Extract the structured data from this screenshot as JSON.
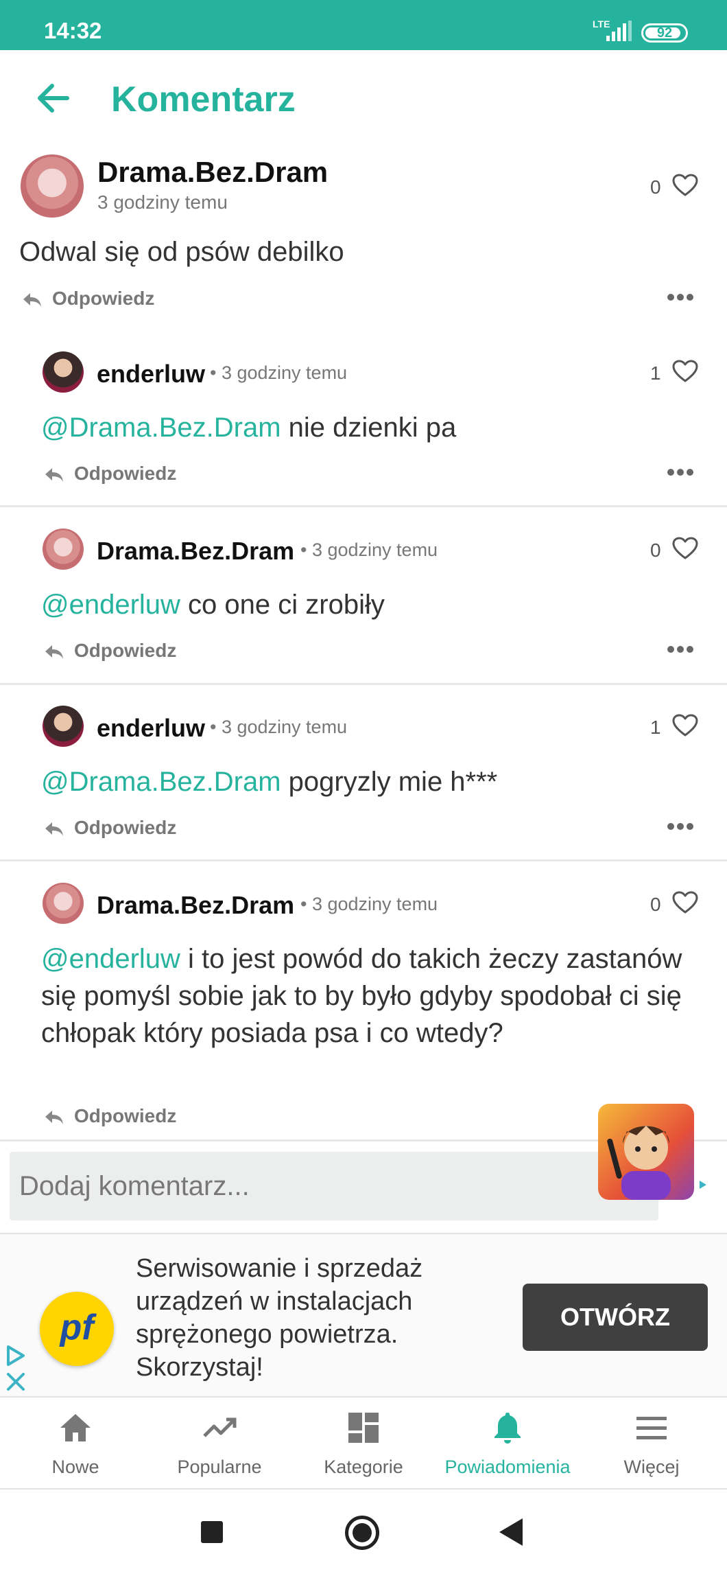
{
  "status_bar": {
    "time": "14:32",
    "network": "LTE",
    "battery": "92"
  },
  "header": {
    "title": "Komentarz"
  },
  "main_comment": {
    "author": "Drama.Bez.Dram",
    "time": "3 godziny temu",
    "likes": "0",
    "text": "Odwal się od psów debilko",
    "reply_label": "Odpowiedz"
  },
  "replies": [
    {
      "author": "enderluw",
      "time": "3 godziny temu",
      "likes": "1",
      "mention": "@Drama.Bez.Dram",
      "text": " nie dzienki pa",
      "reply_label": "Odpowiedz"
    },
    {
      "author": "Drama.Bez.Dram",
      "time": "3 godziny temu",
      "likes": "0",
      "mention": "@enderluw",
      "text": " co one ci zrobiły",
      "reply_label": "Odpowiedz"
    },
    {
      "author": "enderluw",
      "time": "3 godziny temu",
      "likes": "1",
      "mention": "@Drama.Bez.Dram",
      "text": " pogryzly mie h***",
      "reply_label": "Odpowiedz"
    },
    {
      "author": "Drama.Bez.Dram",
      "time": "3 godziny temu",
      "likes": "0",
      "mention": "@enderluw",
      "text": " i to jest powód do takich żeczy zastanów się pomyśl sobie jak to by było gdyby spodobał ci się chłopak który posiada psa i co wtedy?",
      "reply_label": "Odpowiedz"
    }
  ],
  "meta_separator": "•",
  "comment_input": {
    "placeholder": "Dodaj komentarz..."
  },
  "ad": {
    "logo_text": "pf",
    "text": "Serwisowanie i sprzedaż urządzeń w instalacjach sprężonego powietrza. Skorzystaj!",
    "button": "OTWÓRZ"
  },
  "bottom_nav": [
    {
      "label": "Nowe",
      "icon": "home-icon"
    },
    {
      "label": "Popularne",
      "icon": "trending-icon"
    },
    {
      "label": "Kategorie",
      "icon": "dashboard-icon"
    },
    {
      "label": "Powiadomienia",
      "icon": "bell-icon",
      "active": true
    },
    {
      "label": "Więcej",
      "icon": "menu-icon"
    }
  ],
  "colors": {
    "accent": "#25b39e",
    "text": "#333333",
    "muted": "#777777"
  }
}
